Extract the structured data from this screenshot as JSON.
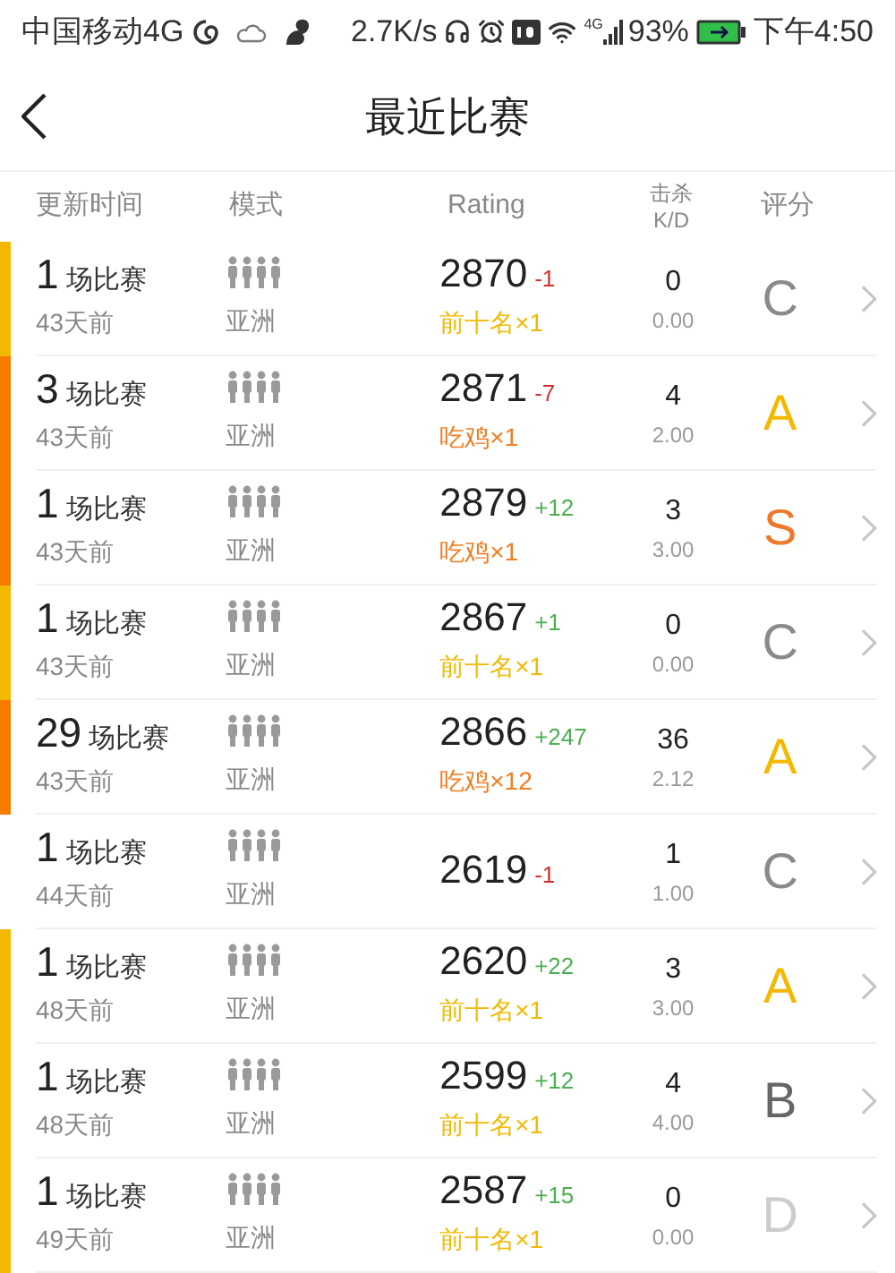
{
  "status_bar": {
    "carrier": "中国移动4G",
    "speed": "2.7K/s",
    "network": "4G",
    "battery": "93%",
    "time": "下午4:50"
  },
  "nav": {
    "title": "最近比赛"
  },
  "columns": [
    {
      "label": "更新时间"
    },
    {
      "label": "模式"
    },
    {
      "label": "Rating"
    },
    {
      "label": "击杀",
      "sublabel": "K/D"
    },
    {
      "label": "评分"
    }
  ],
  "rows": [
    {
      "count": "1",
      "unit": "场比赛",
      "ago": "43天前",
      "mode": "亚洲",
      "rating": "2870",
      "delta": {
        "text": "-1",
        "color": "#d32f2f"
      },
      "badge": {
        "text": "前十名×1",
        "color": "#f5b800"
      },
      "stripe": {
        "color": "#f5b800"
      },
      "kills": "0",
      "kd": "0.00",
      "grade": {
        "text": "C",
        "color": "#8a8a8a"
      }
    },
    {
      "count": "3",
      "unit": "场比赛",
      "ago": "43天前",
      "mode": "亚洲",
      "rating": "2871",
      "delta": {
        "text": "-7",
        "color": "#d32f2f"
      },
      "badge": {
        "text": "吃鸡×1",
        "color": "#f57c1f"
      },
      "stripe": {
        "color": "#f57c00"
      },
      "kills": "4",
      "kd": "2.00",
      "grade": {
        "text": "A",
        "color": "#f5b800"
      }
    },
    {
      "count": "1",
      "unit": "场比赛",
      "ago": "43天前",
      "mode": "亚洲",
      "rating": "2879",
      "delta": {
        "text": "+12",
        "color": "#4caf50"
      },
      "badge": {
        "text": "吃鸡×1",
        "color": "#f57c1f"
      },
      "stripe": {
        "color": "#f57c00"
      },
      "kills": "3",
      "kd": "3.00",
      "grade": {
        "text": "S",
        "color": "#f0782a"
      }
    },
    {
      "count": "1",
      "unit": "场比赛",
      "ago": "43天前",
      "mode": "亚洲",
      "rating": "2867",
      "delta": {
        "text": "+1",
        "color": "#4caf50"
      },
      "badge": {
        "text": "前十名×1",
        "color": "#f5b800"
      },
      "stripe": {
        "color": "#f5b800"
      },
      "kills": "0",
      "kd": "0.00",
      "grade": {
        "text": "C",
        "color": "#8a8a8a"
      }
    },
    {
      "count": "29",
      "unit": "场比赛",
      "ago": "43天前",
      "mode": "亚洲",
      "rating": "2866",
      "delta": {
        "text": "+247",
        "color": "#4caf50"
      },
      "badge": {
        "text": "吃鸡×12",
        "color": "#f57c1f"
      },
      "stripe": {
        "color": "#f57c00"
      },
      "kills": "36",
      "kd": "2.12",
      "grade": {
        "text": "A",
        "color": "#f5b800"
      }
    },
    {
      "count": "1",
      "unit": "场比赛",
      "ago": "44天前",
      "mode": "亚洲",
      "rating": "2619",
      "delta": {
        "text": "-1",
        "color": "#d32f2f"
      },
      "kills": "1",
      "kd": "1.00",
      "grade": {
        "text": "C",
        "color": "#8a8a8a"
      }
    },
    {
      "count": "1",
      "unit": "场比赛",
      "ago": "48天前",
      "mode": "亚洲",
      "rating": "2620",
      "delta": {
        "text": "+22",
        "color": "#4caf50"
      },
      "badge": {
        "text": "前十名×1",
        "color": "#f5b800"
      },
      "stripe": {
        "color": "#f5b800"
      },
      "kills": "3",
      "kd": "3.00",
      "grade": {
        "text": "A",
        "color": "#f5b800"
      }
    },
    {
      "count": "1",
      "unit": "场比赛",
      "ago": "48天前",
      "mode": "亚洲",
      "rating": "2599",
      "delta": {
        "text": "+12",
        "color": "#4caf50"
      },
      "badge": {
        "text": "前十名×1",
        "color": "#f5b800"
      },
      "stripe": {
        "color": "#f5b800"
      },
      "kills": "4",
      "kd": "4.00",
      "grade": {
        "text": "B",
        "color": "#666666"
      }
    },
    {
      "count": "1",
      "unit": "场比赛",
      "ago": "49天前",
      "mode": "亚洲",
      "rating": "2587",
      "delta": {
        "text": "+15",
        "color": "#4caf50"
      },
      "badge": {
        "text": "前十名×1",
        "color": "#f5b800"
      },
      "stripe": {
        "color": "#f5b800"
      },
      "kills": "0",
      "kd": "0.00",
      "grade": {
        "text": "D",
        "color": "#cccccc"
      }
    }
  ]
}
